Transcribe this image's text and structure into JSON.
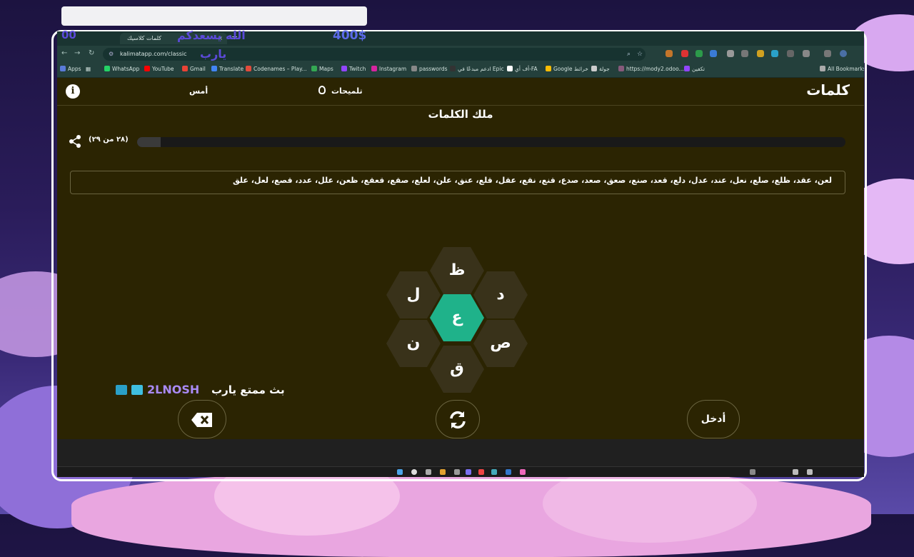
{
  "overlay": {
    "top_text_1": "الله يسعدكم",
    "top_text_2": "يارب",
    "money": "400$",
    "left_tag": "00",
    "stream_text": "بث ممتع يارب",
    "stream_handle": "2LNOSH"
  },
  "browser": {
    "tab_title": "كلمات كلاسيك",
    "new_tab": "+",
    "url": "kalimatapp.com/classic",
    "bookmarks": [
      {
        "label": "Apps",
        "color": "#5a7bd8"
      },
      {
        "label": "WhatsApp",
        "color": "#25d366"
      },
      {
        "label": "YouTube",
        "color": "#ff0000"
      },
      {
        "label": "Gmail",
        "color": "#ea4335"
      },
      {
        "label": "Translate",
        "color": "#4285f4"
      },
      {
        "label": "Codenames – Play...",
        "color": "#e24b3b"
      },
      {
        "label": "Maps",
        "color": "#34a853"
      },
      {
        "label": "Twitch",
        "color": "#9146ff"
      },
      {
        "label": "Instagram",
        "color": "#d6249f"
      },
      {
        "label": "passwords",
        "color": "#888888"
      },
      {
        "label": "ادعم مبدعًا في Epic",
        "color": "#333333"
      },
      {
        "label": "أف أي-FA",
        "color": "#ffffff"
      },
      {
        "label": "Google خرائط",
        "color": "#fbbc04"
      },
      {
        "label": "جولة",
        "color": "#cccccc"
      },
      {
        "label": "https://mody2.odoo...",
        "color": "#875a7b"
      },
      {
        "label": "تكفين",
        "color": "#9146ff"
      }
    ],
    "all_bookmarks": "All Bookmarks"
  },
  "app": {
    "logo": "كلمات",
    "hints_label": "تلميحات",
    "yesterday_label": "أمس",
    "info_label": "i",
    "rank_title": "ملك الكلمات",
    "found_count_text": "(٢٨ من ٢٩)",
    "progress_fraction": 0.0335,
    "found_words": "لعن، عقد، ظلع، صلع، نعل، عند، عدل، دلع، قعد، صنع، صعق، صعد، صدع، قنع، نقع، عقل، قلع، عنق، علن، لعلع، صقع، قعقع، ظعن، علل، عدد، قصع، لعل، علق",
    "letters": {
      "center": "ع",
      "top": "ظ",
      "top_left": "ل",
      "top_right": "د",
      "bottom_left": "ن",
      "bottom_right": "ص",
      "bottom": "ق"
    },
    "enter_label": "أدخل"
  },
  "colors": {
    "page_bg": "#2b2402",
    "center_hex": "#1fb28a",
    "outer_hex": "#39321a",
    "chrome_bg": "#24403c"
  }
}
